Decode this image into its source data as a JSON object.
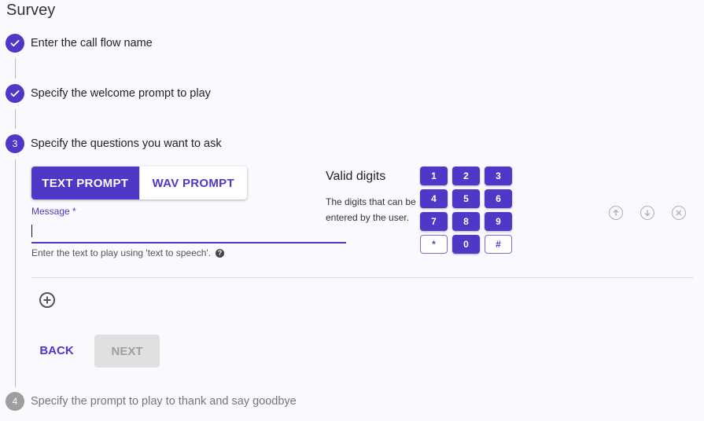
{
  "page": {
    "title": "Survey"
  },
  "steps": [
    {
      "label": "Enter the call flow name",
      "state": "done"
    },
    {
      "label": "Specify the welcome prompt to play",
      "state": "done"
    },
    {
      "label": "Specify the questions you want to ask",
      "state": "active",
      "number": "3"
    },
    {
      "label": "Specify the prompt to play to thank and say goodbye",
      "state": "pending",
      "number": "4"
    }
  ],
  "prompt_toggle": {
    "text_label": "TEXT PROMPT",
    "wav_label": "WAV PROMPT",
    "selected": "TEXT PROMPT"
  },
  "message_field": {
    "label": "Message *",
    "value": "",
    "helper": "Enter the text to play using 'text to speech'."
  },
  "valid_digits": {
    "title": "Valid digits",
    "description": "The digits that can be entered by the user.",
    "keys": [
      "1",
      "2",
      "3",
      "4",
      "5",
      "6",
      "7",
      "8",
      "9",
      "*",
      "0",
      "#"
    ]
  },
  "buttons": {
    "back": "BACK",
    "next": "NEXT"
  },
  "colors": {
    "accent": "#4f37c8",
    "disabled_bg": "#e0e0e0",
    "step_pending": "#9e9e9e"
  },
  "icons": {
    "step_done": "check-icon",
    "move_up": "arrow-up-circle-icon",
    "move_down": "arrow-down-circle-icon",
    "remove": "close-circle-icon",
    "add": "add-circle-icon",
    "help": "help-icon"
  }
}
